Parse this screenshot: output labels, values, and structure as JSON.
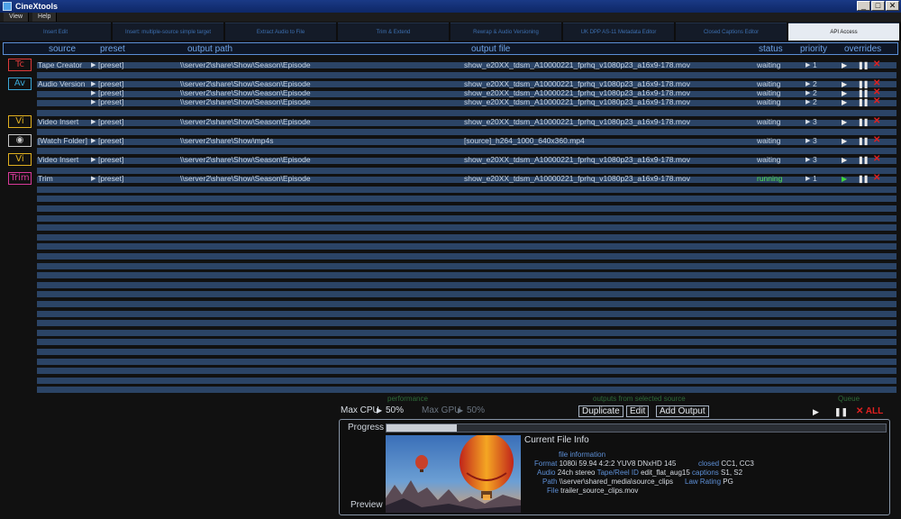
{
  "window": {
    "title": "CineXtools",
    "minimize": "_",
    "maximize": "□",
    "close": "✕"
  },
  "menu": [
    "View",
    "Help"
  ],
  "tabs": [
    {
      "label": "Insert Edit",
      "active": false
    },
    {
      "label": "Insert: multiple-source simple target",
      "active": false
    },
    {
      "label": "Extract Audio to File",
      "active": false
    },
    {
      "label": "Trim & Extend",
      "active": false
    },
    {
      "label": "Rewrap & Audio Versioning",
      "active": false
    },
    {
      "label": "UK DPP AS-11 Metadata Editor",
      "active": false
    },
    {
      "label": "Closed Captions Editor",
      "active": false
    },
    {
      "label": "API Access",
      "active": true
    }
  ],
  "columns": {
    "source": "source",
    "preset": "preset",
    "output_path": "output path",
    "output_file": "output file",
    "status": "status",
    "priority": "priority",
    "overrides": "overrides"
  },
  "jobs": [
    {
      "badge": "Tc",
      "badge_color": "#e03a3a",
      "source": "Tape Creator",
      "preset": "[preset]",
      "path": "\\\\server2\\share\\Show\\Season\\Episode",
      "file": "show_e20XX_tdsm_A10000221_fprhq_v1080p23_a16x9-178.mov",
      "status": "waiting",
      "priority": "1"
    },
    {
      "badge": "Av",
      "badge_color": "#3aa8d8",
      "source": "Audio Version",
      "preset": "[preset]",
      "path": "\\\\server2\\share\\Show\\Season\\Episode",
      "file": "show_e20XX_tdsm_A10000221_fprhq_v1080p23_a16x9-178.mov",
      "status": "waiting",
      "priority": "2"
    },
    {
      "badge": "",
      "badge_color": "",
      "source": "",
      "preset": "[preset]",
      "path": "\\\\server2\\share\\Show\\Season\\Episode",
      "file": "show_e20XX_tdsm_A10000221_fprhq_v1080p23_a16x9-178.mov",
      "status": "waiting",
      "priority": "2"
    },
    {
      "badge": "",
      "badge_color": "",
      "source": "",
      "preset": "[preset]",
      "path": "\\\\server2\\share\\Show\\Season\\Episode",
      "file": "show_e20XX_tdsm_A10000221_fprhq_v1080p23_a16x9-178.mov",
      "status": "waiting",
      "priority": "2"
    },
    {
      "badge": "Vi",
      "badge_color": "#e0b020",
      "source": "Video Insert",
      "preset": "[preset]",
      "path": "\\\\server2\\share\\Show\\Season\\Episode",
      "file": "show_e20XX_tdsm_A10000221_fprhq_v1080p23_a16x9-178.mov",
      "status": "waiting",
      "priority": "3"
    },
    {
      "badge": "eye",
      "badge_color": "#c8c8c8",
      "source": "[Watch Folder]",
      "preset": "[preset]",
      "path": "\\\\server2\\share\\Show\\mp4s",
      "file": "[source]_h264_1000_640x360.mp4",
      "status": "waiting",
      "priority": "3"
    },
    {
      "badge": "Vi",
      "badge_color": "#e0b020",
      "source": "Video Insert",
      "preset": "[preset]",
      "path": "\\\\server2\\share\\Show\\Season\\Episode",
      "file": "show_e20XX_tdsm_A10000221_fprhq_v1080p23_a16x9-178.mov",
      "status": "waiting",
      "priority": "3"
    },
    {
      "badge": "Trim",
      "badge_color": "#d83a9a",
      "source": "Trim",
      "preset": "[preset]",
      "path": "\\\\server2\\share\\Show\\Season\\Episode",
      "file": "show_e20XX_tdsm_A10000221_fprhq_v1080p23_a16x9-178.mov",
      "status": "running",
      "priority": "1"
    }
  ],
  "bottom": {
    "performance_label": "performance",
    "max_cpu_label": "Max CPU",
    "max_cpu_value": "50%",
    "max_gpu_label": "Max GPU",
    "max_gpu_value": "50%",
    "outputs_label": "outputs from selected source",
    "duplicate": "Duplicate",
    "edit": "Edit",
    "add_output": "Add Output",
    "queue_label": "Queue",
    "x_all": "✕ ALL"
  },
  "info": {
    "progress_label": "Progress",
    "progress_fraction": 0.14,
    "preview_label": "Preview",
    "current_file_title": "Current File Info",
    "file_information": "file information",
    "format_k": "Format",
    "format_v": "1080i 59.94 4:2:2 YUV8 DNxHD 145",
    "closed_k": "closed",
    "closed_v": "CC1, CC3",
    "audio_k": "Audio",
    "audio_v": "24ch stereo",
    "tape_k": "Tape/Reel ID",
    "tape_v": "edit_flat_aug15",
    "captions_k": "captions",
    "captions_v": "S1, S2",
    "path_k": "Path",
    "path_v": "\\\\server\\shared_media\\source_clips",
    "rating_k": "Law Rating",
    "rating_v": "PG",
    "file_k": "File",
    "file_v": "trailer_source_clips.mov"
  }
}
